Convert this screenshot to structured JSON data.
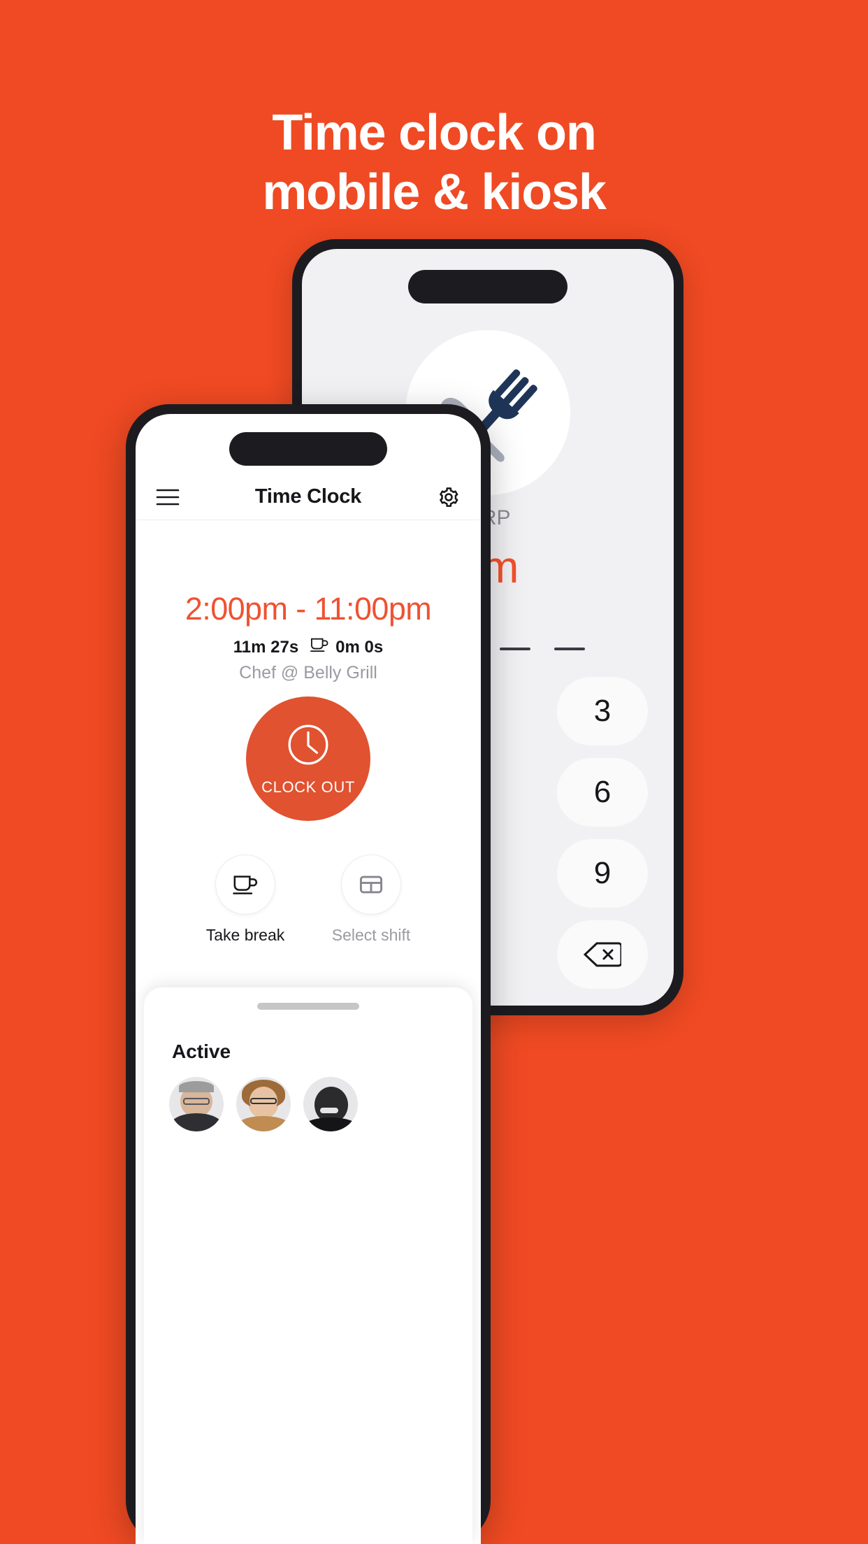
{
  "page": {
    "background_color": "#EF4A23",
    "headline_lines": [
      "Time clock on",
      "mobile & kiosk"
    ]
  },
  "back_phone": {
    "name": "kiosk-phone",
    "logo_icon": "fork-knife-icon",
    "company_name": "ORP",
    "clock_time": "am",
    "keypad": [
      {
        "label": "",
        "name": "blank"
      },
      {
        "label": "",
        "name": "blank"
      },
      {
        "label": "3",
        "name": "key-3"
      },
      {
        "label": "",
        "name": "blank"
      },
      {
        "label": "",
        "name": "blank"
      },
      {
        "label": "6",
        "name": "key-6"
      },
      {
        "label": "",
        "name": "blank"
      },
      {
        "label": "",
        "name": "blank"
      },
      {
        "label": "9",
        "name": "key-9"
      },
      {
        "label": "",
        "name": "blank"
      },
      {
        "label": "",
        "name": "blank"
      },
      {
        "label": "⌫",
        "name": "key-backspace"
      }
    ]
  },
  "front_phone": {
    "app_bar": {
      "menu_icon": "hamburger-menu-icon",
      "title": "Time Clock",
      "settings_icon": "gear-icon"
    },
    "shift": {
      "range": "2:00pm - 11:00pm",
      "worked_time": "11m 27s",
      "break_icon": "coffee-cup-icon",
      "break_time": "0m 0s",
      "role": "Chef @ Belly Grill"
    },
    "clock_button": {
      "icon": "clock-icon",
      "label": "CLOCK OUT",
      "color": "#e05230"
    },
    "actions": [
      {
        "icon": "coffee-cup-icon",
        "label": "Take break",
        "disabled": false
      },
      {
        "icon": "calendar-grid-icon",
        "label": "Select shift",
        "disabled": true
      }
    ],
    "sheet": {
      "title": "Active",
      "avatars": [
        "avatar-1",
        "avatar-2",
        "avatar-3"
      ]
    }
  }
}
